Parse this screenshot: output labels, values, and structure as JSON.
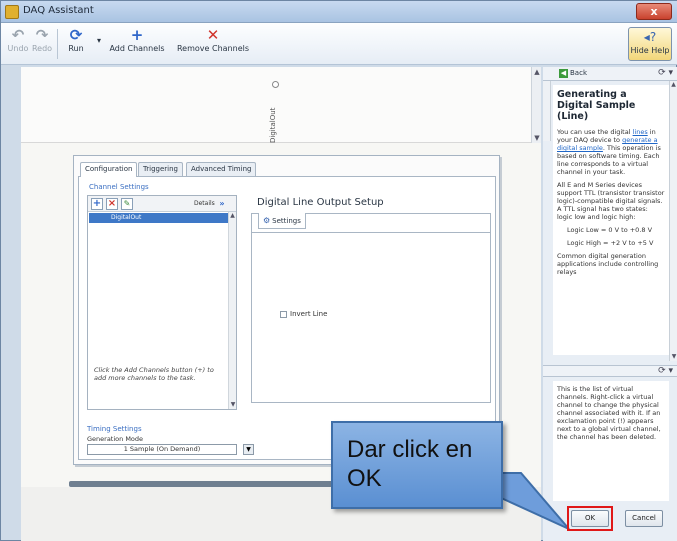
{
  "window": {
    "title": "DAQ Assistant",
    "close_label": "x"
  },
  "toolbar": {
    "undo_label": "Undo",
    "redo_label": "Redo",
    "run_label": "Run",
    "add_channels_label": "Add Channels",
    "remove_channels_label": "Remove Channels",
    "hide_help_label": "Hide Help"
  },
  "graph": {
    "channel_label": "DigitalOut"
  },
  "config": {
    "tabs": [
      {
        "label": "Configuration"
      },
      {
        "label": "Triggering"
      },
      {
        "label": "Advanced Timing"
      }
    ],
    "channel_settings_label": "Channel Settings",
    "details_label": "Details",
    "details_button": "»",
    "channel_item": "DigitalOut",
    "channel_hint": "Click the Add Channels button (+) to add more channels to the task.",
    "setup_title": "Digital Line Output Setup",
    "settings_tab": "Settings",
    "invert_line_label": "Invert Line",
    "timing_settings_label": "Timing Settings",
    "generation_mode_label": "Generation Mode",
    "generation_mode_value": "1 Sample (On Demand)"
  },
  "help": {
    "back_label": "Back",
    "title": "Generating a Digital Sample (Line)",
    "paragraph1_pre": "You can use the digital ",
    "paragraph1_link1": "lines",
    "paragraph1_mid": " in your DAQ device to ",
    "paragraph1_link2": "generate a digital sample",
    "paragraph1_post": ". This operation is based on software timing. Each line corresponds to a virtual channel in your task.",
    "paragraph2": "All E and M Series devices support TTL (transistor transistor logic)-compatible digital signals. A TTL signal has two states: logic low and logic high:",
    "logic_low": "Logic Low = 0 V to +0.8 V",
    "logic_high": "Logic High = +2 V to +5 V",
    "paragraph3": "Common digital generation applications include controlling relays",
    "lower_text": "This is the list of virtual channels. Right-click a virtual channel to change the physical channel associated with it. If an exclamation point (!) appears next to a global virtual channel, the channel has been deleted."
  },
  "callout": {
    "text": "Dar click en OK"
  },
  "buttons": {
    "ok_label": "OK",
    "cancel_label": "Cancel"
  },
  "colors": {
    "accent": "#3e78c7",
    "callout_fill": "#6f9fdc",
    "highlight": "#e01818"
  }
}
